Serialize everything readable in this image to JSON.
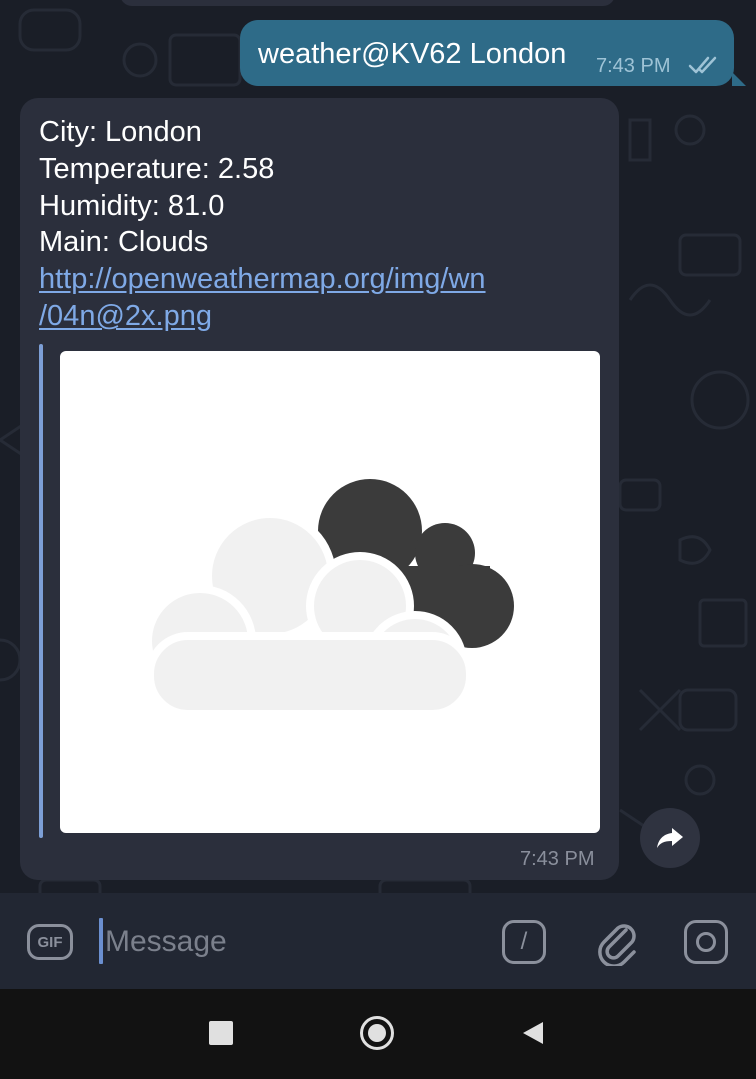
{
  "outgoing": {
    "text": "weather@KV62 London",
    "time": "7:43 PM",
    "status_icon": "double-check-icon"
  },
  "incoming": {
    "lines": [
      "City: London",
      "Temperature: 2.58",
      "Humidity: 81.0",
      "Main: Clouds"
    ],
    "link_lines": [
      "http://openweathermap.org/img/wn",
      "/04n@2x.png"
    ],
    "preview_icon": "broken-clouds-icon",
    "time": "7:43 PM"
  },
  "forward_icon": "share-arrow-icon",
  "input_bar": {
    "gif_label": "GIF",
    "placeholder": "Message",
    "command_label": "/",
    "attach_icon": "paperclip-icon",
    "camera_icon": "camera-icon"
  },
  "nav": {
    "recents_icon": "square-icon",
    "home_icon": "circle-icon",
    "back_icon": "triangle-back-icon"
  },
  "colors": {
    "chat_background": "#1a1e27",
    "outgoing_bubble": "#2e6b88",
    "incoming_bubble": "#2b2f3c",
    "link": "#7fa9e6",
    "accent": "#7d9fd6"
  }
}
